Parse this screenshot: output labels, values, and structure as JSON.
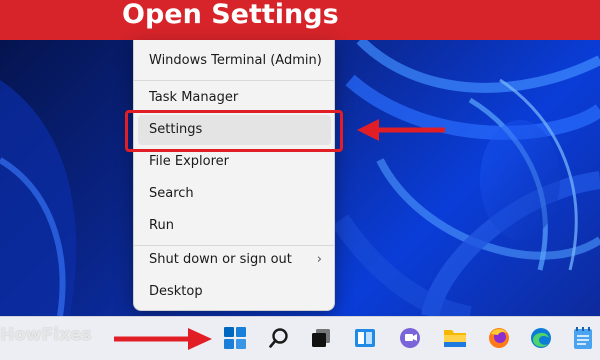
{
  "banner": {
    "title": "Open Settings"
  },
  "context_menu": {
    "items": [
      {
        "label": "Windows Terminal (Admin)"
      },
      {
        "label": "Task Manager"
      },
      {
        "label": "Settings"
      },
      {
        "label": "File Explorer"
      },
      {
        "label": "Search"
      },
      {
        "label": "Run"
      },
      {
        "label": "Shut down or sign out",
        "has_submenu": true,
        "chevron": "›"
      },
      {
        "label": "Desktop"
      }
    ],
    "highlighted_item": "Settings"
  },
  "taskbar": {
    "watermark": "HowFixes",
    "icons": [
      "start-icon",
      "search-icon",
      "task-view-icon",
      "widgets-icon",
      "teams-chat-icon",
      "file-explorer-icon",
      "firefox-icon",
      "edge-icon",
      "notepad-icon"
    ]
  },
  "colors": {
    "banner": "#d6242a",
    "annotation_red": "#e11e26",
    "start_blue": "#0067c0"
  }
}
